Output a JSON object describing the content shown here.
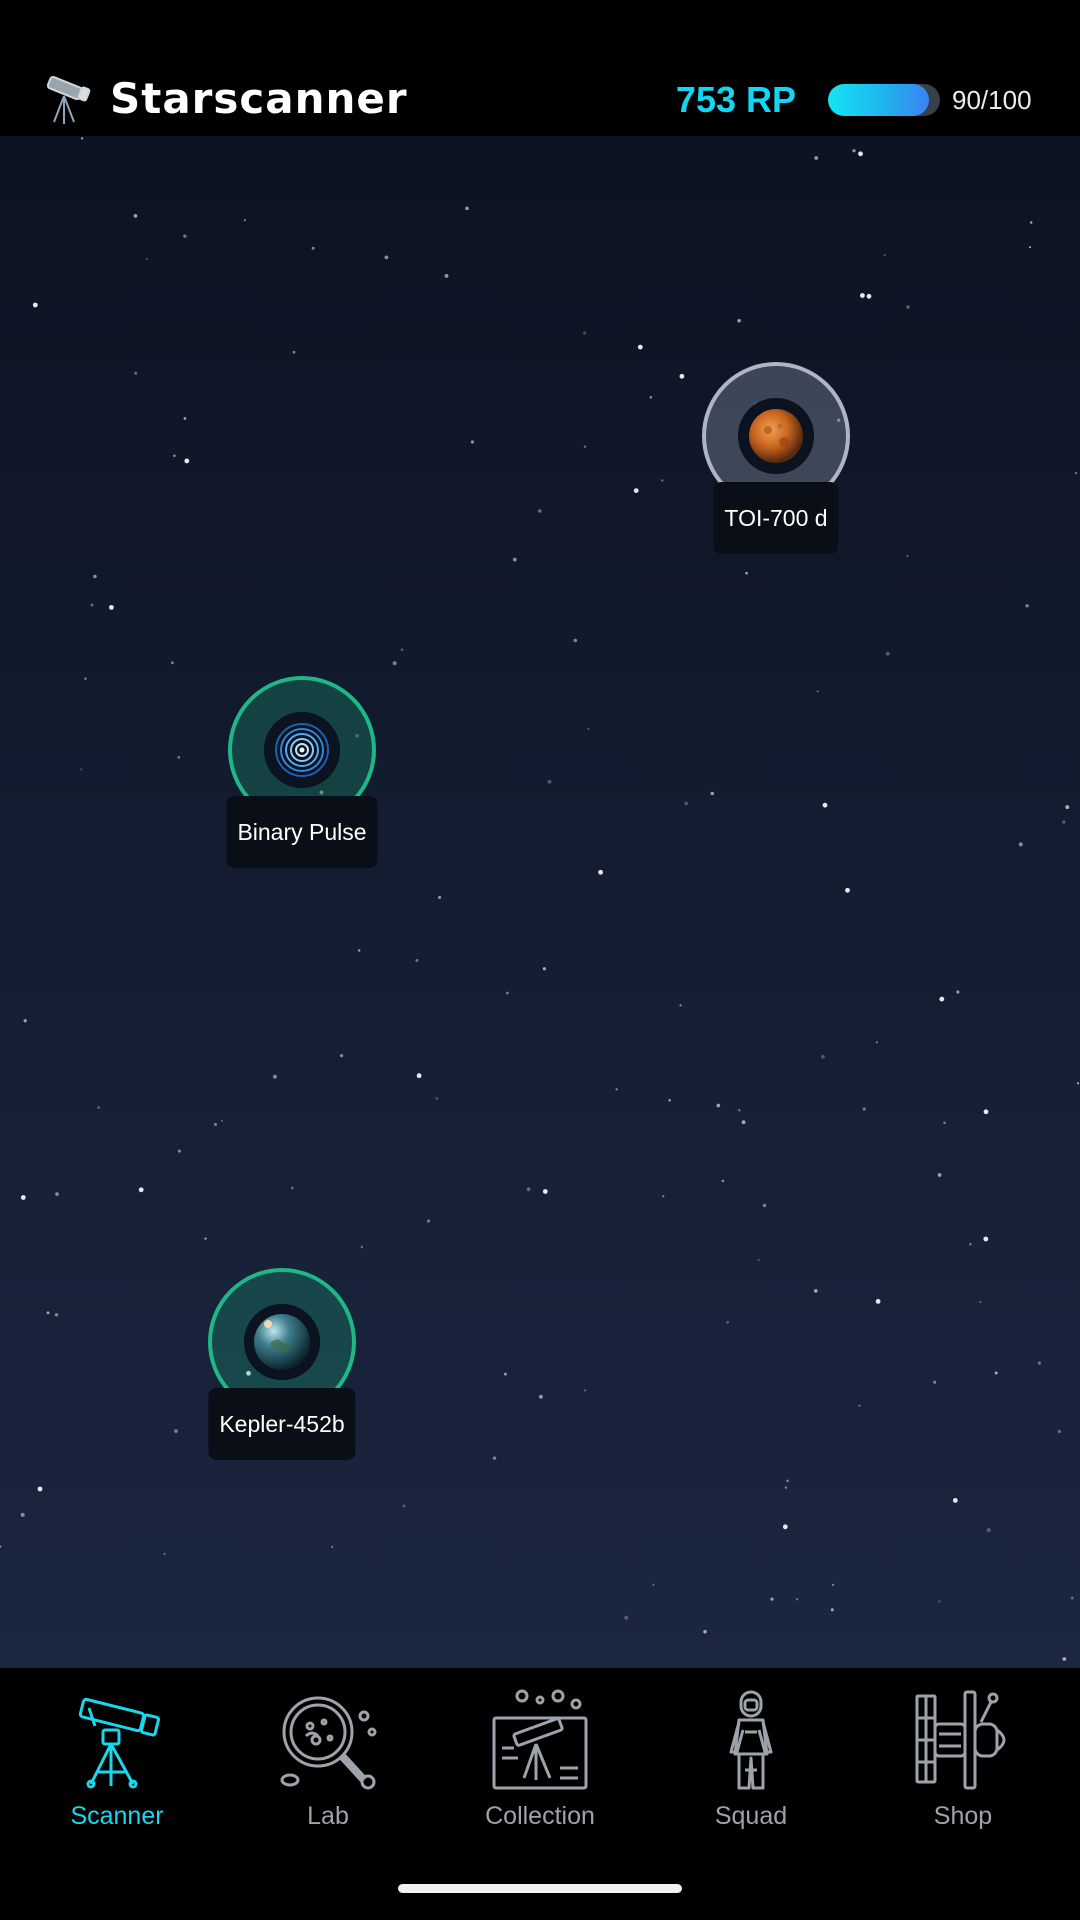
{
  "app": {
    "title": "Starscanner",
    "logo_icon": "telescope-icon"
  },
  "resources": {
    "rp_label": "753 RP",
    "energy_text": "90/100",
    "energy_current": 90,
    "energy_max": 100
  },
  "targets": [
    {
      "name": "TOI-700 d",
      "icon": "rocky-planet-icon",
      "status": "locked",
      "ring_color": "#aeb6c6"
    },
    {
      "name": "Binary Pulse",
      "icon": "pulsar-icon",
      "status": "available",
      "ring_color": "#1fb786"
    },
    {
      "name": "Kepler-452b",
      "icon": "earthlike-planet-icon",
      "status": "available",
      "ring_color": "#1fb786"
    }
  ],
  "nav": {
    "items": [
      {
        "label": "Scanner",
        "icon": "telescope-icon",
        "active": true
      },
      {
        "label": "Lab",
        "icon": "magnifier-icon",
        "active": false
      },
      {
        "label": "Collection",
        "icon": "collection-icon",
        "active": false
      },
      {
        "label": "Squad",
        "icon": "astronaut-icon",
        "active": false
      },
      {
        "label": "Shop",
        "icon": "satellite-icon",
        "active": false
      }
    ]
  },
  "colors": {
    "accent": "#18d8ee",
    "inactive": "#9ea3ab",
    "sky_top": "#0c1322",
    "sky_bottom": "#1b2640"
  }
}
